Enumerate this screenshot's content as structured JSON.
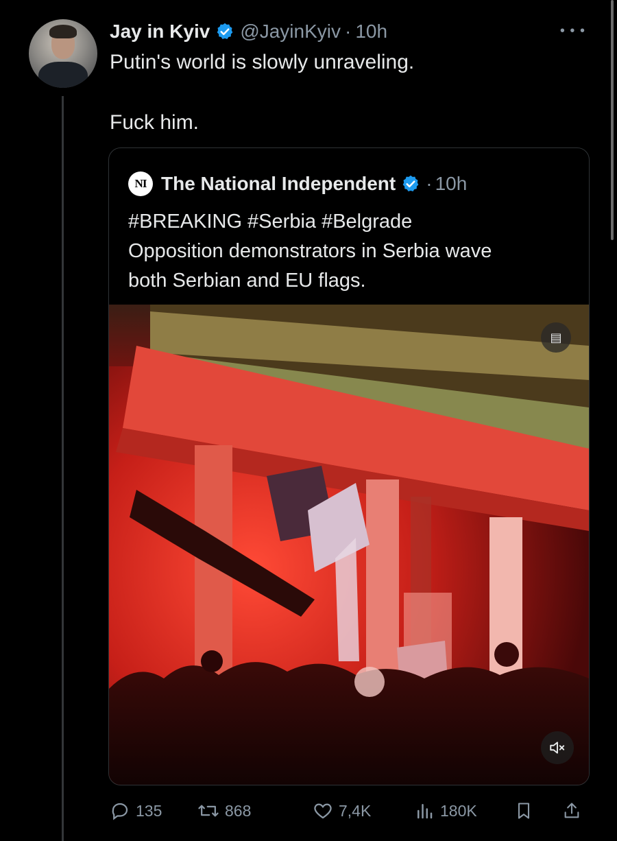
{
  "tweet": {
    "display_name": "Jay in Kyiv",
    "handle": "@JayinKyiv",
    "separator": "·",
    "time": "10h",
    "text_line1": "Putin's world is slowly unraveling.",
    "text_line2": "Fuck him."
  },
  "quote": {
    "logo_text": "NI",
    "display_name": "The National Independent",
    "separator": "·",
    "time": "10h",
    "text_line1": "#BREAKING #Serbia #Belgrade",
    "text_line2": "Opposition demonstrators in Serbia wave",
    "text_line3": "both Serbian and EU flags."
  },
  "actions": {
    "replies": "135",
    "reposts": "868",
    "likes": "7,4K",
    "views": "180K"
  },
  "colors": {
    "background": "#000000",
    "text": "#e7e9ea",
    "muted": "#8b98a5",
    "verified": "#1d9bf0",
    "border": "#2f3336"
  },
  "icons": [
    "verified-icon",
    "more-icon",
    "reply-icon",
    "repost-icon",
    "like-icon",
    "views-icon",
    "bookmark-icon",
    "share-icon",
    "mute-icon",
    "caption-icon"
  ]
}
